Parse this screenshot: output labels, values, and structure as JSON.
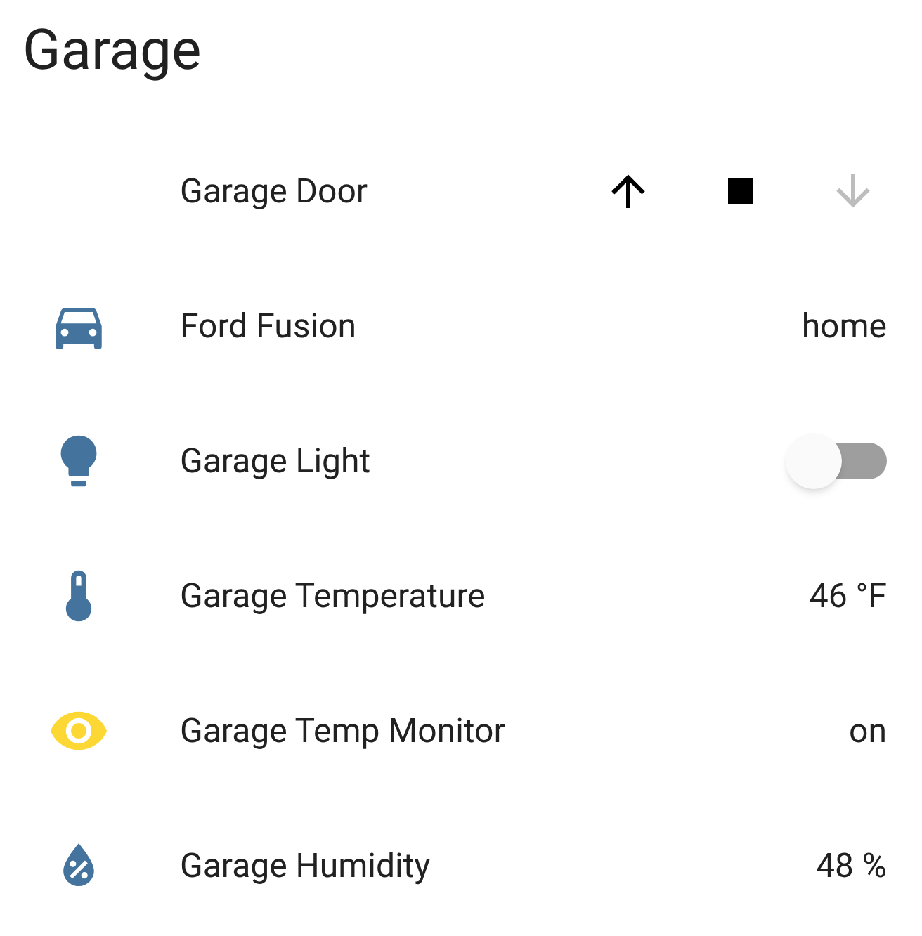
{
  "title": "Garage",
  "entities": [
    {
      "kind": "cover",
      "name": "Garage Door",
      "buttons": [
        {
          "kind": "up",
          "disabled": false
        },
        {
          "kind": "stop",
          "disabled": false
        },
        {
          "kind": "down",
          "disabled": true
        }
      ]
    },
    {
      "kind": "sensor",
      "name": "Ford Fusion",
      "value": "home",
      "color": "#44739e"
    },
    {
      "kind": "toggle",
      "name": "Garage Light",
      "on": false,
      "color": "#44739e"
    },
    {
      "kind": "sensor",
      "name": "Garage Temperature",
      "value": "46 °F",
      "color": "#44739e"
    },
    {
      "kind": "sensor",
      "name": "Garage Temp Monitor",
      "value": "on",
      "color": "#fdd835"
    },
    {
      "kind": "sensor",
      "name": "Garage Humidity",
      "value": "48 %",
      "color": "#44739e"
    }
  ]
}
